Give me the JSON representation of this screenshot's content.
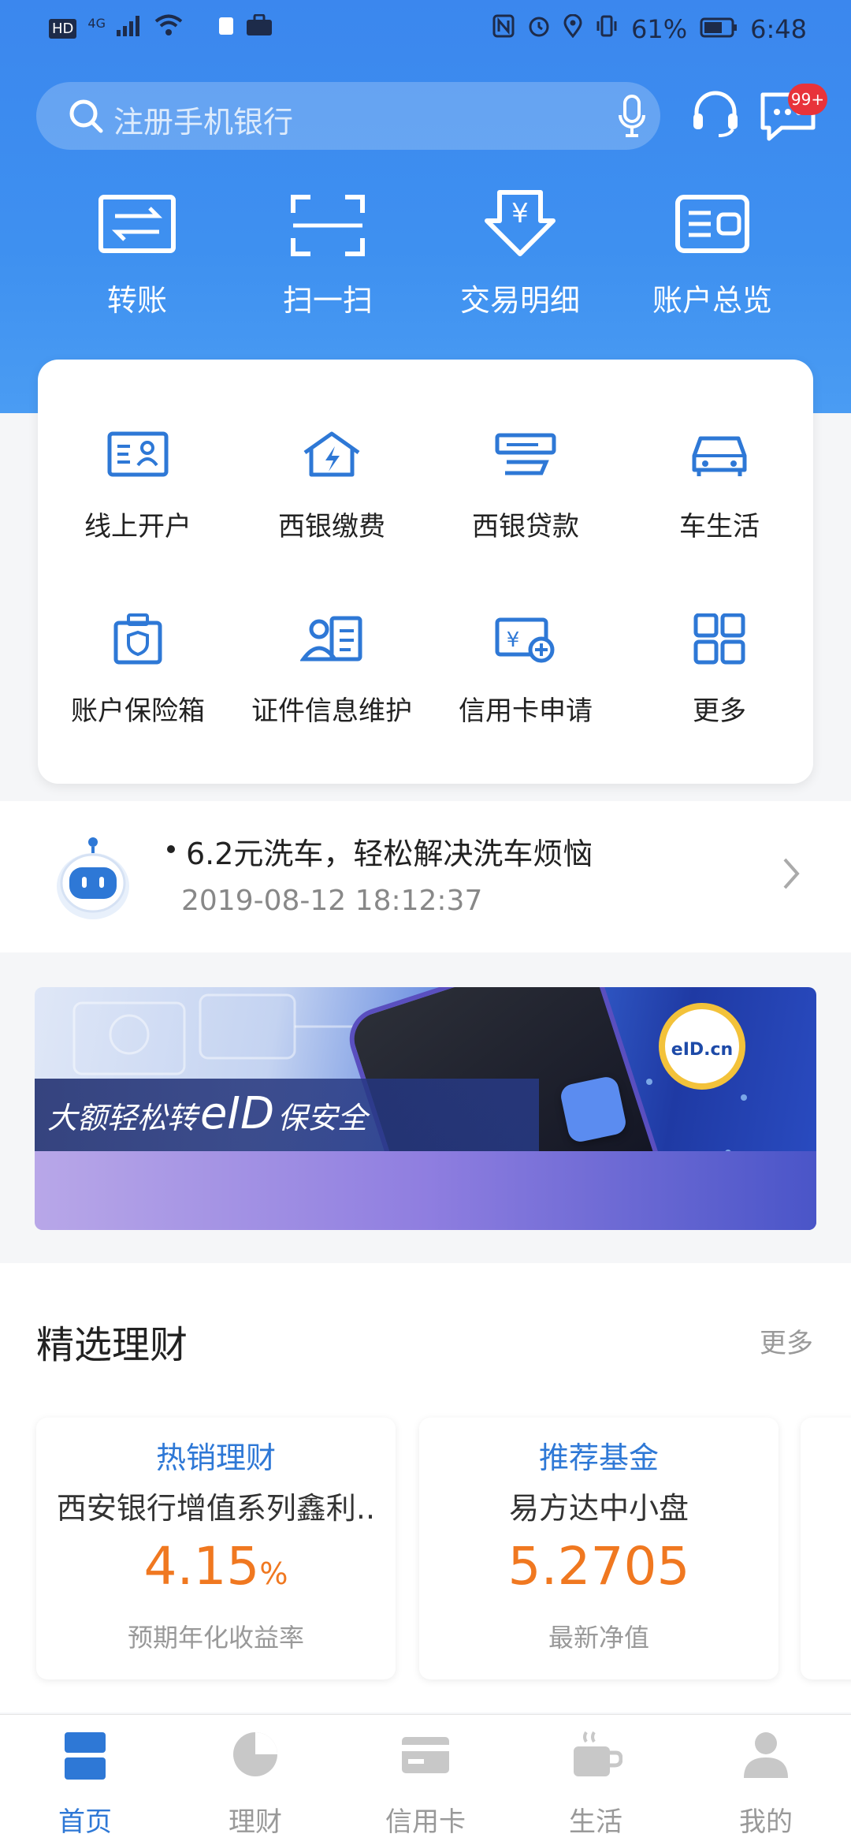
{
  "status_bar": {
    "network": "HD",
    "signal": "4G",
    "battery": "61%",
    "time": "6:48"
  },
  "search": {
    "placeholder": "注册手机银行",
    "badge": "99+"
  },
  "quick_actions": [
    {
      "label": "转账",
      "icon": "transfer-icon"
    },
    {
      "label": "扫一扫",
      "icon": "scan-icon"
    },
    {
      "label": "交易明细",
      "icon": "transaction-detail-icon"
    },
    {
      "label": "账户总览",
      "icon": "account-overview-icon"
    }
  ],
  "services": [
    {
      "label": "线上开户",
      "icon": "id-card-icon"
    },
    {
      "label": "西银缴费",
      "icon": "house-bolt-icon"
    },
    {
      "label": "西银贷款",
      "icon": "loan-icon"
    },
    {
      "label": "车生活",
      "icon": "car-icon"
    },
    {
      "label": "账户保险箱",
      "icon": "safe-box-icon"
    },
    {
      "label": "证件信息维护",
      "icon": "profile-card-icon"
    },
    {
      "label": "信用卡申请",
      "icon": "credit-card-add-icon"
    },
    {
      "label": "更多",
      "icon": "grid-icon"
    }
  ],
  "notice": {
    "message": "6.2元洗车，轻松解决洗车烦恼",
    "timestamp": "2019-08-12 18:12:37"
  },
  "banner": {
    "text_before": "大额轻松转",
    "text_highlight": "eID",
    "text_after": "保安全",
    "logo": "eID.cn"
  },
  "featured": {
    "title": "精选理财",
    "more": "更多",
    "products": [
      {
        "category": "热销理财",
        "name": "西安银行增值系列鑫利..",
        "value": "4.15",
        "unit": "%",
        "value_label": "预期年化收益率"
      },
      {
        "category": "推荐基金",
        "name": "易方达中小盘",
        "value": "5.2705",
        "unit": "",
        "value_label": "最新净值"
      }
    ]
  },
  "tabs": [
    {
      "label": "首页",
      "active": true
    },
    {
      "label": "理财",
      "active": false
    },
    {
      "label": "信用卡",
      "active": false
    },
    {
      "label": "生活",
      "active": false
    },
    {
      "label": "我的",
      "active": false
    }
  ],
  "colors": {
    "primary": "#2e78d6",
    "header_blue": "#3e90f0",
    "accent_orange": "#f07820",
    "badge_red": "#e8333a"
  }
}
